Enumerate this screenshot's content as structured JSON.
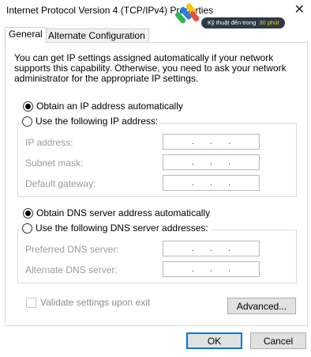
{
  "window": {
    "title": "Internet Protocol Version 4 (TCP/IPv4) Properties",
    "close_glyph": "✕"
  },
  "watermark": {
    "text": "Kỹ thuật đến trong",
    "highlight": "30 phút"
  },
  "tabs": [
    {
      "label": "General",
      "active": true
    },
    {
      "label": "Alternate Configuration",
      "active": false
    }
  ],
  "description": "You can get IP settings assigned automatically if your network supports this capability. Otherwise, you need to ask your network administrator for the appropriate IP settings.",
  "ip_mode": {
    "auto_label": "Obtain an IP address automatically",
    "manual_label": "Use the following IP address:",
    "selected": "auto"
  },
  "ip_fields": [
    {
      "label": "IP address:",
      "dots": [
        ".",
        ".",
        "."
      ]
    },
    {
      "label": "Subnet mask:",
      "dots": [
        ".",
        ".",
        "."
      ]
    },
    {
      "label": "Default gateway:",
      "dots": [
        ".",
        ".",
        "."
      ]
    }
  ],
  "dns_mode": {
    "auto_label": "Obtain DNS server address automatically",
    "manual_label": "Use the following DNS server addresses:",
    "selected": "auto"
  },
  "dns_fields": [
    {
      "label": "Preferred DNS server:",
      "dots": [
        ".",
        ".",
        "."
      ]
    },
    {
      "label": "Alternate DNS server:",
      "dots": [
        ".",
        ".",
        "."
      ]
    }
  ],
  "validate": {
    "label": "Validate settings upon exit",
    "checked": false,
    "enabled": false
  },
  "buttons": {
    "advanced": "Advanced...",
    "ok": "OK",
    "cancel": "Cancel"
  }
}
